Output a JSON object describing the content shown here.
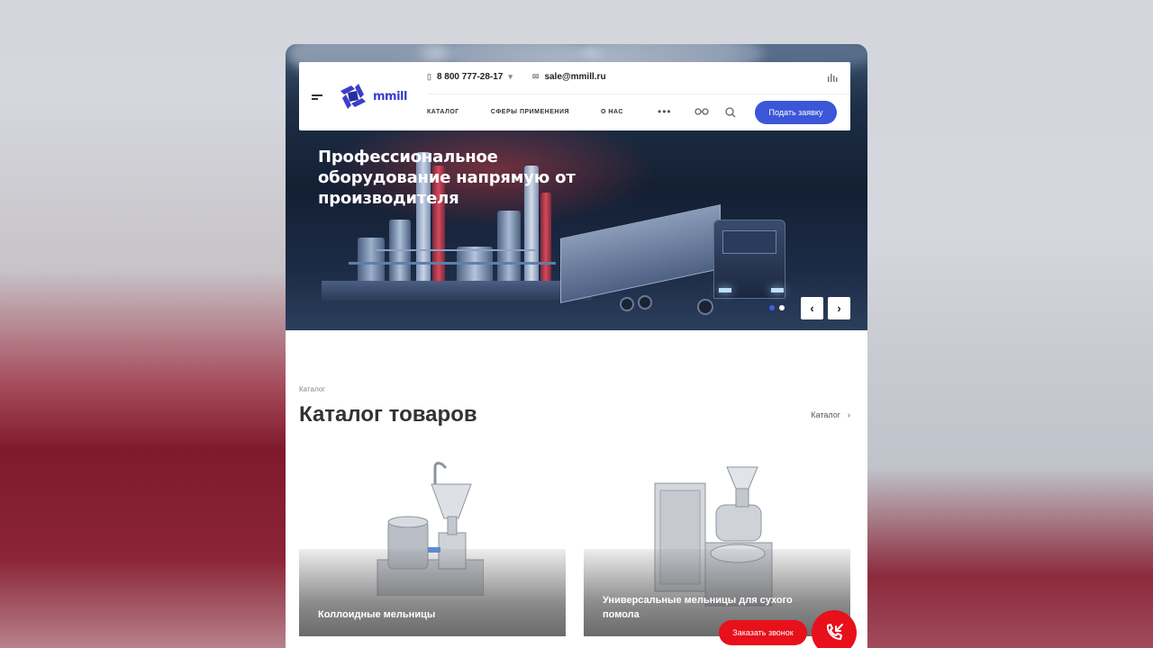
{
  "header": {
    "logo_text": "mmill",
    "phone": "8 800 777-28-17",
    "email": "sale@mmill.ru",
    "nav": [
      "КАТАЛОГ",
      "СФЕРЫ ПРИМЕНЕНИЯ",
      "О НАС"
    ],
    "more": "•••",
    "cta_label": "Подать заявку"
  },
  "hero": {
    "title": "Профессиональное оборудование напрямую от производителя",
    "slides_total": 2,
    "active_slide": 1
  },
  "catalog": {
    "breadcrumb": "Каталог",
    "title": "Каталог товаров",
    "link_label": "Каталог",
    "cards": [
      {
        "label": "Коллоидные мельницы"
      },
      {
        "label": "Универсальные мельницы для сухого помола"
      }
    ]
  },
  "floating": {
    "callback_label": "Заказать звонок"
  },
  "colors": {
    "accent": "#3b57d8",
    "callback": "#e8101a"
  }
}
